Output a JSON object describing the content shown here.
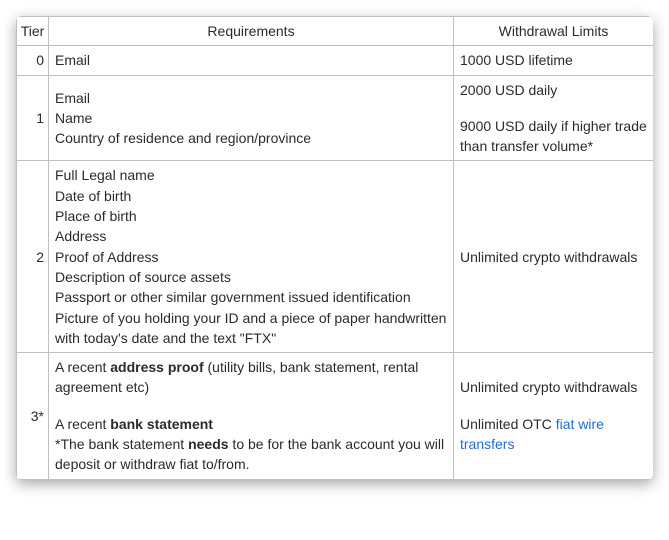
{
  "headers": {
    "tier": "Tier",
    "requirements": "Requirements",
    "limits": "Withdrawal Limits"
  },
  "rows": {
    "r0": {
      "tier": "0",
      "req": "Email",
      "lim": "1000 USD lifetime"
    },
    "r1": {
      "tier": "1",
      "req": {
        "l1": "Email",
        "l2": "Name",
        "l3": "Country of residence and region/province"
      },
      "lim": {
        "p1": "2000 USD daily",
        "p2": "9000 USD daily if higher trade than transfer volume*"
      }
    },
    "r2": {
      "tier": "2",
      "req": {
        "l1": "Full Legal name",
        "l2": "Date of birth",
        "l3": "Place of birth",
        "l4": "Address",
        "l5": "Proof of Address",
        "l6": "Description of source assets",
        "l7": "Passport or other similar government issued identification",
        "l8": "Picture of you holding your ID and a piece of paper handwritten with today's date and the text \"FTX\""
      },
      "lim": "Unlimited crypto withdrawals"
    },
    "r3": {
      "tier": "3*",
      "req": {
        "p1a": "A recent ",
        "p1b": "address proof",
        "p1c": " (utility bills, bank statement, rental agreement etc)",
        "p2a": "A recent ",
        "p2b": "bank statement",
        "p3a": "*The bank statement ",
        "p3b": "needs",
        "p3c": " to be for the bank account you will deposit or withdraw fiat to/from."
      },
      "lim": {
        "p1": "Unlimited crypto withdrawals",
        "p2a": "Unlimited OTC ",
        "p2b": "fiat wire transfers"
      }
    }
  }
}
